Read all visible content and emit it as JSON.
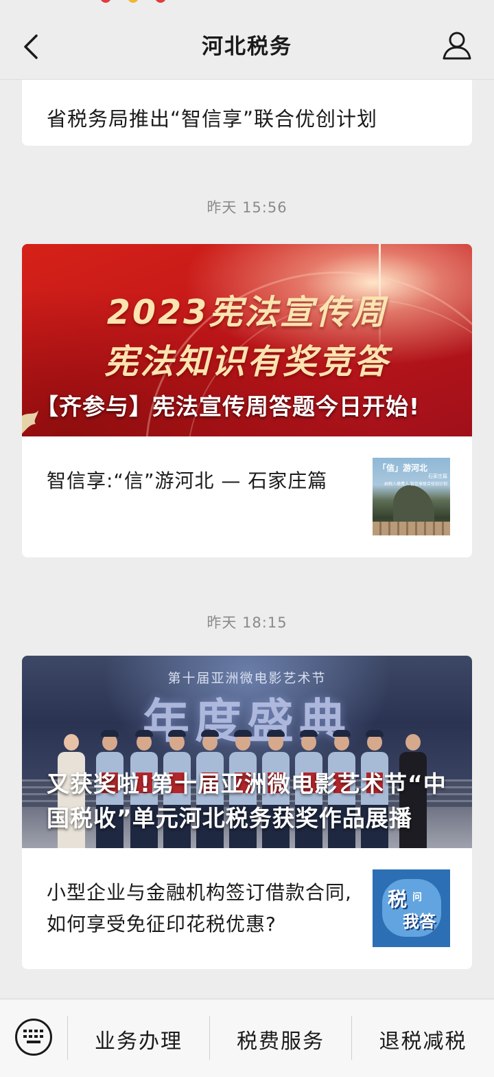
{
  "header": {
    "title": "河北税务",
    "back_icon": "chevron-left-icon",
    "profile_icon": "person-icon"
  },
  "messages": {
    "top_card": {
      "text": "省税务局推出“智信享”联合优创计划"
    },
    "group1": {
      "timestamp": "昨天 15:56",
      "banner": {
        "line1": "2023宪法宣传周",
        "line2": "宪法知识有奖竞答",
        "caption": "【齐参与】宪法宣传周答题今日开始!"
      },
      "item": {
        "text": "智信享:“信”游河北 — 石家庄篇",
        "thumb_line1": "「信」游河北",
        "thumb_line2": "石家庄篇",
        "thumb_line3": "纳税人缴费人 智信享联合优创计划"
      }
    },
    "group2": {
      "timestamp": "昨天 18:15",
      "banner": {
        "festival_title": "第十届亚洲微电影艺术节",
        "festival_big": "年度盛典",
        "caption": "又获奖啦!第十届亚洲微电影艺术节“中国税收”单元河北税务获奖作品展播"
      },
      "item": {
        "text": "小型企业与金融机构签订借款合同,如何享受免征印花税优惠?",
        "thumb_line1": "税",
        "thumb_line2": "问",
        "thumb_line3": "我答"
      }
    }
  },
  "bottom_bar": {
    "keyboard_icon": "keyboard-icon",
    "menu1": "业务办理",
    "menu2": "税费服务",
    "menu3": "退税减税"
  },
  "colors": {
    "background": "#ededed",
    "banner_red": "#c3171a",
    "banner_text_gold": "#fbe4b0",
    "timestamp_gray": "#8a8a8a"
  }
}
